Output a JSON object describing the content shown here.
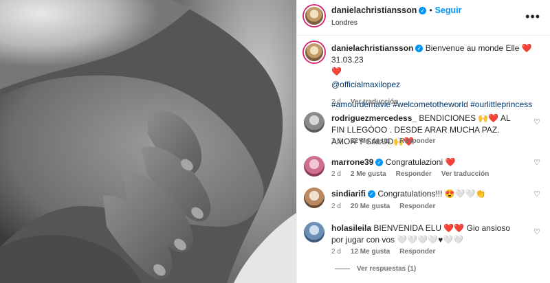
{
  "post": {
    "username": "danielachristiansson",
    "follow_label": "Seguir",
    "location": "Londres",
    "separator": "•"
  },
  "caption": {
    "username": "danielachristiansson",
    "text": "Bienvenue au monde Elle",
    "heart": "❤️",
    "date": "31.03.23",
    "heart2": "❤️",
    "mention": "@officialmaxilopez",
    "hashtags": "#amourdemavie #welcometotheworld #ourlittleprincess",
    "age": "2 d",
    "translate_label": "Ver traducción"
  },
  "comments": [
    {
      "username": "rodriguezmercedess_",
      "text": "BENDICIONES 🙌❤️ AL FIN LLEGÓOO . DESDE ARAR MUCHA PAZ. AMOR Y SALUD🙌❤️",
      "age": "2 d",
      "likes": "32 Me gusta",
      "reply_label": "Responder"
    },
    {
      "username": "marrone39",
      "text": "Congratulazioni ❤️",
      "age": "2 d",
      "likes": "2 Me gusta",
      "reply_label": "Responder",
      "translate_label": "Ver traducción"
    },
    {
      "username": "sindiarifi",
      "text": "Congratulations!!! 😍🤍🤍👏",
      "age": "2 d",
      "likes": "20 Me gusta",
      "reply_label": "Responder"
    },
    {
      "username": "holasileila",
      "text": "BIENVENIDA ELU ❤️❤️ Gio ansioso por jugar con vos 🤍🤍🤍🤍♥🤍🤍",
      "age": "2 d",
      "likes": "12 Me gusta",
      "reply_label": "Responder",
      "replies_label": "Ver respuestas (1)"
    }
  ],
  "colors": {
    "accent": "#0095f6",
    "verified": "#0095f6",
    "heart": "#ed4956",
    "muted": "#737373",
    "link": "#00376b"
  },
  "icons": {
    "more": "more-horizontal-icon",
    "verified": "verified-badge-icon",
    "like": "heart-outline-icon"
  }
}
